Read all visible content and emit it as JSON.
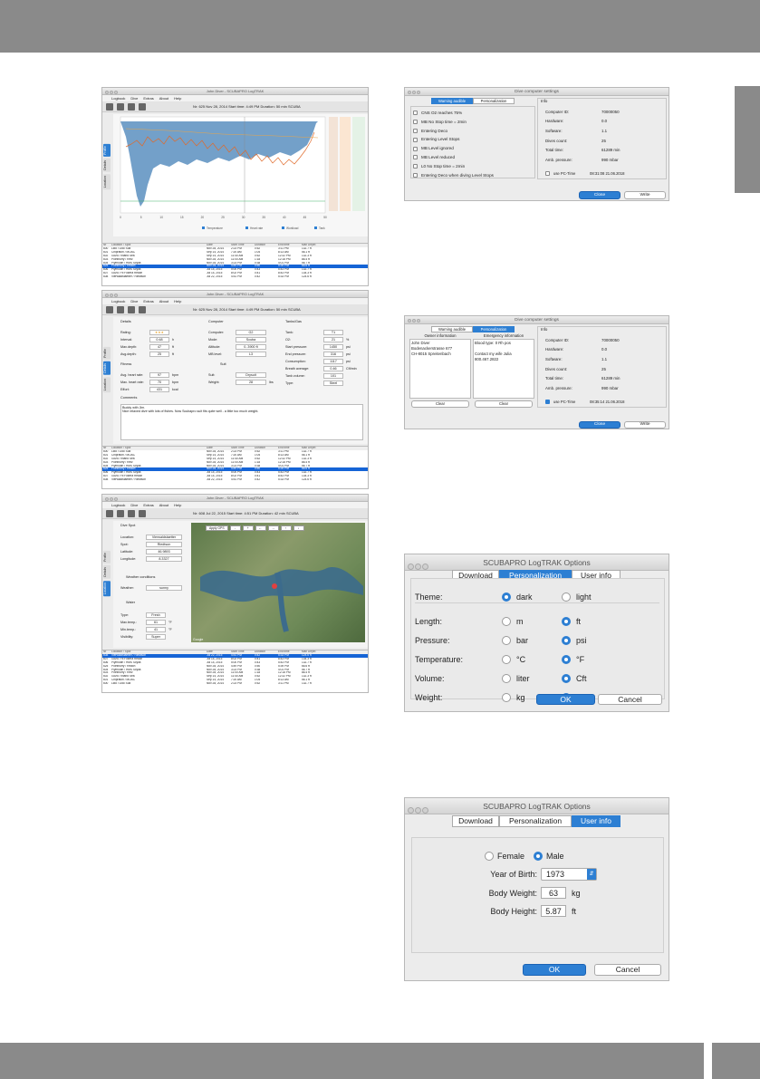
{
  "colors": {
    "bar_gray": "#8a8a8a",
    "accent": "#2d7fd3",
    "profile_fill": "#5b8fc0",
    "temp_line": "#e06a2a"
  },
  "win1": {
    "title": "John Diver - SCUBAPRO LogTRAK",
    "menu": [
      "Logbook",
      "Dive",
      "Extras",
      "About",
      "Help"
    ],
    "info": "Nr: 625    Nov 28, 2014    Start time: 4:49 PM    Duration: 50 min    SCUBA",
    "tabs": [
      "Profile",
      "Details",
      "Location"
    ],
    "legend": [
      "Temperature",
      "Heart rate",
      "Workload",
      "Tank"
    ],
    "ticks_x": [
      "0",
      "5",
      "10",
      "15",
      "20",
      "25",
      "30",
      "35",
      "40",
      "45",
      "50"
    ],
    "rows": [
      [
        "Nr",
        "Location / Spot",
        "Date",
        "Start Time",
        "Duration",
        "End time",
        "Max Depth"
      ],
      [
        "600",
        "Lido / Lido Sud",
        "Nov 28, 2014",
        "2:23 PM",
        "0:52",
        "3:11 PM",
        "132.7 ft"
      ],
      [
        "601",
        "Chipraton / MOAC",
        "Sep 14, 2014",
        "7:20 AM",
        "1:04",
        "8:13 AM",
        "56.1 ft"
      ],
      [
        "602",
        "Gozo / Inland Sea",
        "Sep 14, 2014",
        "11:40 AM",
        "0:52",
        "12:32 PM",
        "132.3 ft"
      ],
      [
        "603",
        "Pointhurry / Reiz",
        "Nov 28, 2014",
        "11:00 AM",
        "1:18",
        "12:18 PM",
        "86.4 ft"
      ],
      [
        "604",
        "Plymouth / HMS Scylla",
        "Nov 28, 2014",
        "3:23 PM",
        "0:38",
        "4:01 PM",
        "56.7 ft"
      ],
      [
        "625",
        "Pointhurry / Reach",
        "Nov 28, 2014",
        "4:49 PM",
        "0:50",
        "5:39 PM",
        "66.6 ft"
      ],
      [
        "606",
        "Plymouth / HMS Scylla",
        "Jul 14, 2015",
        "5:00 PM",
        "0:43",
        "5:43 PM",
        "132.7 ft"
      ],
      [
        "607",
        "Gozo / Hl Fokera Reach",
        "Jul 14, 2015",
        "8:02 PM",
        "0:41",
        "8:43 PM",
        "134.3 ft"
      ],
      [
        "608",
        "Vierwaldstaetter / Riedtson",
        "Jul 22, 2015",
        "4:51 PM",
        "0:42",
        "5:33 PM",
        "124.6 ft"
      ]
    ]
  },
  "win2": {
    "title": "John Diver - SCUBAPRO LogTRAK",
    "menu": [
      "Logbook",
      "Dive",
      "Extras",
      "About",
      "Help"
    ],
    "info": "Nr: 625    Nov 28, 2014    Start time: 4:49 PM    Duration: 50 min    SCUBA",
    "tabs": [
      "Profile",
      "Details",
      "Location"
    ],
    "sec_details": "Details",
    "sec_computer": "Computer",
    "sec_tanks": "Tanks/Gas",
    "sec_fitness": "Fitness",
    "sec_suit": "Suit",
    "sec_comments": "Comments",
    "details": [
      [
        "Rating:",
        "★★★",
        ""
      ],
      [
        "Interval:",
        "0:48",
        "h"
      ],
      [
        "Max.depth:",
        "47",
        "ft"
      ],
      [
        "Avg.depth:",
        "25",
        "ft"
      ]
    ],
    "computer": [
      [
        "Computer:",
        "G2"
      ],
      [
        "Mode:",
        "Scuba"
      ],
      [
        "Altitude:",
        "0..3900 ft"
      ],
      [
        "MB level:",
        "L3"
      ]
    ],
    "tanks": [
      [
        "Tank:",
        "T1",
        ""
      ],
      [
        "O2:",
        "21",
        "%"
      ],
      [
        "Start pressure:",
        "1450",
        "psi"
      ],
      [
        "End pressure:",
        "316",
        "psi"
      ],
      [
        "Consumption:",
        "1117",
        "psi"
      ],
      [
        "Breath average:",
        "0.46",
        "Cft/min"
      ],
      [
        "Tank volume:",
        "101",
        ""
      ],
      [
        "Type:",
        "Steel",
        ""
      ]
    ],
    "fitness": [
      [
        "Avg. heart rate:",
        "97",
        "bpm"
      ],
      [
        "Max. heart rate:",
        "70",
        "bpm"
      ],
      [
        "Effort:",
        "431",
        "kcal"
      ]
    ],
    "suit": [
      [
        "Suit:",
        "Drysuit"
      ],
      [
        "Weight:",
        "28",
        "lbs"
      ]
    ],
    "comment": "Buddy with Jim.\nNice relaxed dive with lots of fishes. Now Scubapro suit fits quite well - a little too much weight.",
    "rows": [
      [
        "Nr",
        "Location / Spot",
        "Date",
        "Start Time",
        "Duration",
        "End time",
        "Max Depth"
      ],
      [
        "600",
        "Lido / Lido Sud",
        "Nov 28, 2014",
        "2:23 PM",
        "0:52",
        "3:11 PM",
        "132.7 ft"
      ],
      [
        "601",
        "Chipraton / MOAC",
        "Sep 14, 2014",
        "7:20 AM",
        "1:04",
        "8:13 AM",
        "56.1 ft"
      ],
      [
        "602",
        "Gozo / Inland Sea",
        "Sep 14, 2014",
        "11:40 AM",
        "0:52",
        "12:32 PM",
        "132.3 ft"
      ],
      [
        "603",
        "Pointhurry / Reiz",
        "Nov 28, 2014",
        "11:00 AM",
        "1:18",
        "12:18 PM",
        "86.4 ft"
      ],
      [
        "604",
        "Plymouth / HMS Scylla",
        "Nov 28, 2014",
        "3:23 PM",
        "0:38",
        "4:01 PM",
        "56.7 ft"
      ],
      [
        "625",
        "Pointhurry / Reach",
        "Nov 28, 2014",
        "4:49 PM",
        "0:50",
        "5:39 PM",
        "66.6 ft"
      ],
      [
        "606",
        "Plymouth / HMS Scylla",
        "Jul 14, 2015",
        "5:00 PM",
        "0:43",
        "5:43 PM",
        "132.7 ft"
      ],
      [
        "607",
        "Gozo / Hl Fokera Reach",
        "Jul 14, 2015",
        "8:02 PM",
        "0:41",
        "8:43 PM",
        "134.3 ft"
      ],
      [
        "608",
        "Vierwaldstaetter / Riedtson",
        "Jul 22, 2015",
        "4:51 PM",
        "0:42",
        "5:33 PM",
        "124.6 ft"
      ]
    ]
  },
  "win3": {
    "title": "John Diver - SCUBAPRO LogTRAK",
    "menu": [
      "Logbook",
      "Dive",
      "Extras",
      "About",
      "Help"
    ],
    "info": "Nr: 608    Jul 22, 2015    Start time: 4:51 PM    Duration: 42 min    SCUBA",
    "tabs": [
      "Profile",
      "Details",
      "Location"
    ],
    "sec_spot": "Dive Spot",
    "sec_weather": "Weather conditions",
    "sec_water": "Water",
    "spot": [
      [
        "Location:",
        "Vierwaldstaetter"
      ],
      [
        "Spot:",
        "Riedtson"
      ],
      [
        "Latitude:",
        "46.9893"
      ],
      [
        "Longitude:",
        "8.3327"
      ]
    ],
    "weather": [
      [
        "Weather:",
        "sunny"
      ]
    ],
    "water": [
      [
        "Type:",
        "Fresh",
        ""
      ],
      [
        "Max.temp.:",
        "61",
        "°F"
      ],
      [
        "Min.temp.:",
        "41",
        "°F"
      ],
      [
        "Visibility:",
        "Super",
        ""
      ]
    ],
    "map_buttons": [
      "Apply GPS",
      "-",
      "+",
      "←",
      "→",
      "↑",
      "↓"
    ],
    "map_credit": "Google",
    "rows": [
      [
        "Nr",
        "Location / Spot",
        "Date",
        "Start Time",
        "Duration",
        "End time",
        "Max Depth"
      ],
      [
        "608",
        "Vierwaldstaetter / Riedtson",
        "Jul 22, 2015",
        "4:51 PM",
        "0:42",
        "5:33 PM",
        "124.6 ft"
      ],
      [
        "607",
        "Gozo / Hl Fokera Reach",
        "Jul 14, 2015",
        "8:02 PM",
        "0:41",
        "8:43 PM",
        "134.3 ft"
      ],
      [
        "606",
        "Plymouth / HMS Scylla",
        "Jul 14, 2015",
        "5:00 PM",
        "0:43",
        "5:43 PM",
        "132.7 ft"
      ],
      [
        "625",
        "Pointhurry / Reach",
        "Nov 28, 2014",
        "4:49 PM",
        "0:50",
        "5:39 PM",
        "66.6 ft"
      ],
      [
        "604",
        "Plymouth / HMS Scylla",
        "Nov 28, 2014",
        "3:23 PM",
        "0:38",
        "4:01 PM",
        "56.7 ft"
      ],
      [
        "603",
        "Pointhurry / Reiz",
        "Nov 28, 2014",
        "11:00 AM",
        "1:18",
        "12:18 PM",
        "86.4 ft"
      ],
      [
        "602",
        "Gozo / Inland Sea",
        "Sep 14, 2014",
        "11:40 AM",
        "0:52",
        "12:32 PM",
        "132.3 ft"
      ],
      [
        "601",
        "Chipraton / MOAC",
        "Sep 14, 2014",
        "7:20 AM",
        "1:04",
        "8:13 AM",
        "56.1 ft"
      ],
      [
        "600",
        "Lido / Lido Sud",
        "Nov 28, 2014",
        "2:23 PM",
        "0:52",
        "3:11 PM",
        "132.7 ft"
      ]
    ]
  },
  "dcs1": {
    "title": "Dive computer settings",
    "tabs": [
      "Warning audible",
      "Personalization"
    ],
    "warnings": [
      [
        "CNS O2 reaches 75%",
        false
      ],
      [
        "MB No Stop time = 2min",
        false
      ],
      [
        "Entering Deco",
        false
      ],
      [
        "Entering Level Stops",
        false
      ],
      [
        "MB Level ignored",
        false
      ],
      [
        "MB Level reduced",
        false
      ],
      [
        "L0 No Stop time = 2min",
        false
      ],
      [
        "Entering Deco when diving Level Stops",
        false
      ]
    ],
    "info_label": "Info",
    "info": [
      [
        "Computer ID:",
        "70000050"
      ],
      [
        "Hardware:",
        "0.0"
      ],
      [
        "Software:",
        "1.1"
      ],
      [
        "Dives count:",
        "25"
      ],
      [
        "Total time:",
        "61289 min"
      ],
      [
        "Amb. pressure:",
        "990 mbar"
      ]
    ],
    "pc_time": "use PC-Time",
    "pc_time_value": "08:31:08  21.06.2018",
    "close": "Close",
    "write": "Write"
  },
  "dcs2": {
    "title": "Dive computer settings",
    "tabs": [
      "Warning audible",
      "Personalization"
    ],
    "owner_header": "Owner information",
    "emergency_header": "Emergency information",
    "owner_lines": [
      "John Diver",
      "Bodenackerstrasse 677",
      "CH-8015 Spreitenbach"
    ],
    "emergency_lines": [
      "Blood type: 0 Rh pos",
      "",
      "Contact my wife Julia",
      "800.467.2822"
    ],
    "clear": "Clear",
    "info_label": "Info",
    "info": [
      [
        "Computer ID:",
        "70000050"
      ],
      [
        "Hardware:",
        "0.0"
      ],
      [
        "Software:",
        "1.1"
      ],
      [
        "Dives count:",
        "25"
      ],
      [
        "Total time:",
        "61289 min"
      ],
      [
        "Amb. pressure:",
        "990 mbar"
      ]
    ],
    "pc_time": "use PC-Time",
    "pc_time_value": "08:35:14  21.06.2018",
    "close": "Close",
    "write": "Write"
  },
  "opt1": {
    "title": "SCUBAPRO LogTRAK Options",
    "tabs": [
      "Download",
      "Personalization",
      "User info"
    ],
    "theme": {
      "label": "Theme:",
      "a": "dark",
      "b": "light",
      "sel": "a"
    },
    "units": [
      {
        "label": "Length:",
        "a": "m",
        "b": "ft",
        "sel": "b"
      },
      {
        "label": "Pressure:",
        "a": "bar",
        "b": "psi",
        "sel": "b"
      },
      {
        "label": "Temperature:",
        "a": "°C",
        "b": "°F",
        "sel": "b"
      },
      {
        "label": "Volume:",
        "a": "liter",
        "b": "Cft",
        "sel": "b"
      },
      {
        "label": "Weight:",
        "a": "kg",
        "b": "lbs",
        "sel": "b"
      }
    ],
    "ok": "OK",
    "cancel": "Cancel"
  },
  "opt2": {
    "title": "SCUBAPRO LogTRAK Options",
    "tabs": [
      "Download",
      "Personalization",
      "User info"
    ],
    "female": "Female",
    "male": "Male",
    "year_label": "Year of Birth:",
    "year": "1973",
    "weight_label": "Body Weight:",
    "weight": "63",
    "weight_unit": "kg",
    "height_label": "Body Height:",
    "height": "5.87",
    "height_unit": "ft",
    "ok": "OK",
    "cancel": "Cancel"
  }
}
